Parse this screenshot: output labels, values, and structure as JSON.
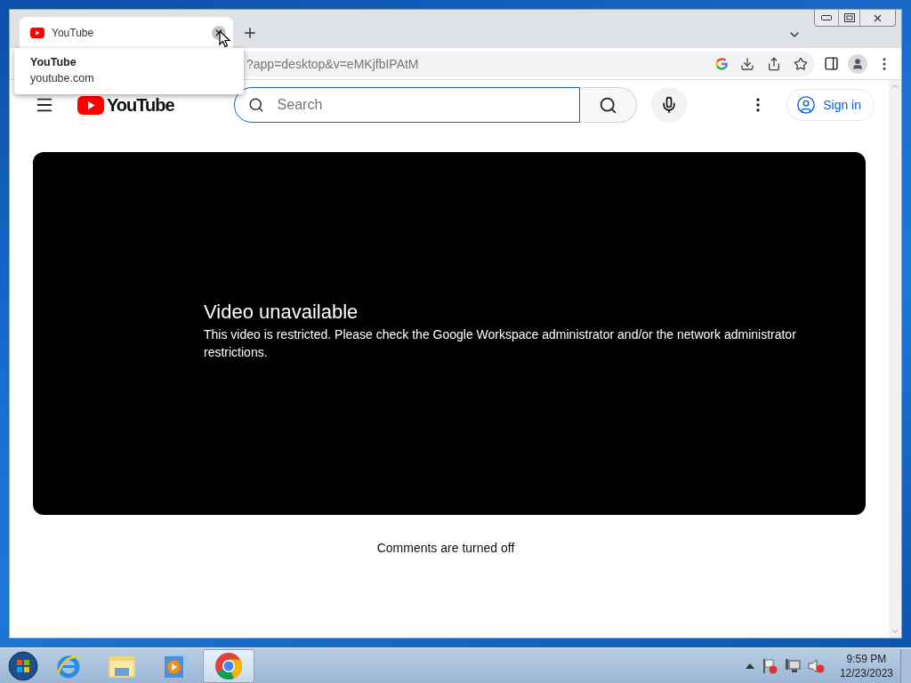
{
  "tab": {
    "title": "YouTube",
    "selected": true
  },
  "tooltip": {
    "title": "YouTube",
    "host": "youtube.com"
  },
  "address_bar": {
    "url": "?app=desktop&v=eMKjfbIPAtM"
  },
  "page": {
    "logo": "YouTube",
    "search": {
      "placeholder": "Search"
    },
    "sign_in": "Sign in",
    "player": {
      "title": "Video unavailable",
      "message": "This video is restricted. Please check the Google Workspace administrator and/or the network administrator restrictions."
    },
    "comments": "Comments are turned off"
  },
  "taskbar": {
    "apps": [
      {
        "kind": "ie",
        "selected": false
      },
      {
        "kind": "explorer",
        "selected": false
      },
      {
        "kind": "media",
        "selected": false
      },
      {
        "kind": "chrome",
        "selected": true
      }
    ],
    "clock": {
      "time": "9:59 PM",
      "date": "12/23/2023"
    }
  }
}
